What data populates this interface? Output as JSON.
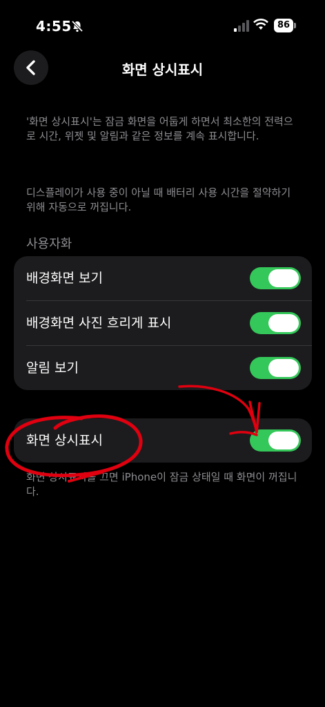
{
  "status": {
    "time": "4:55",
    "battery": "86",
    "icons": [
      "bell-slash-icon",
      "signal-icon",
      "wifi-icon",
      "battery-icon"
    ]
  },
  "nav": {
    "back_icon": "chevron-left-icon",
    "title": "화면 상시표시"
  },
  "description_1": "'화면 상시표시'는 잠금 화면을 어둡게 하면서 최소한의 전력으로 시간, 위젯 및 알림과 같은 정보를 계속 표시합니다.",
  "description_2": "디스플레이가 사용 중이 아닐 때 배터리 사용 시간을 절약하기 위해 자동으로 꺼집니다.",
  "customization": {
    "header": "사용자화",
    "items": [
      {
        "label": "배경화면 보기",
        "on": true
      },
      {
        "label": "배경화면 사진 흐리게 표시",
        "on": true
      },
      {
        "label": "알림 보기",
        "on": true
      }
    ]
  },
  "main_toggle": {
    "label": "화면 상시표시",
    "on": true
  },
  "footer_note": "화면 상시표시를 끄면 iPhone이 잠금 상태일 때 화면이 꺼집니다.",
  "colors": {
    "background": "#000000",
    "cell": "#1c1c1e",
    "toggle_on": "#34c759",
    "secondary_text": "#8e8e93",
    "annotation": "#e0000f"
  }
}
